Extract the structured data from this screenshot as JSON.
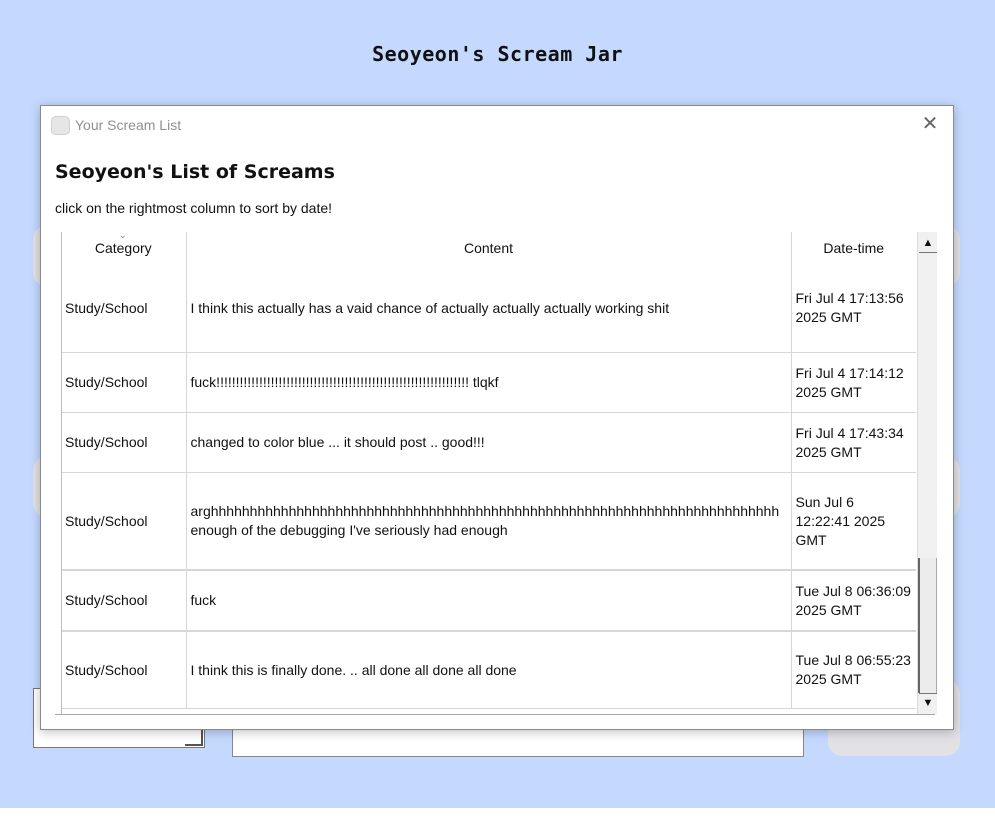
{
  "page": {
    "app_title": "Seoyeon's Scream Jar"
  },
  "dialog": {
    "window_title": "Your Scream List",
    "close_label": "✕",
    "heading": "Seoyeon's List of Screams",
    "hint": "click on the rightmost column to sort by date!"
  },
  "table": {
    "columns": [
      "Category",
      "Content",
      "Date-time"
    ],
    "rows": [
      {
        "category": "Study/School",
        "content": "I think this actually has a vaid chance of actually actually actually working shit",
        "datetime": "Fri Jul 4 17:13:56 2025 GMT"
      },
      {
        "category": "Study/School",
        "content": "fuck!!!!!!!!!!!!!!!!!!!!!!!!!!!!!!!!!!!!!!!!!!!!!!!!!!!!!!!!!!!!!!!!! tlqkf",
        "datetime": "Fri Jul 4 17:14:12 2025 GMT"
      },
      {
        "category": "Study/School",
        "content": "changed to color blue ... it should post .. good!!!",
        "datetime": "Fri Jul 4 17:43:34 2025 GMT"
      },
      {
        "category": "Study/School",
        "content": "arghhhhhhhhhhhhhhhhhhhhhhhhhhhhhhhhhhhhhhhhhhhhhhhhhhhhhhhhhhhhhhhhhhhhhhhhh enough of the debugging I've seriously had enough",
        "datetime": "Sun Jul 6 12:22:41 2025 GMT"
      },
      {
        "category": "Study/School",
        "content": "fuck",
        "datetime": "Tue Jul 8 06:36:09 2025 GMT"
      },
      {
        "category": "Study/School",
        "content": "I think this is finally done. .. all done all done all done",
        "datetime": "Tue Jul 8 06:55:23 2025 GMT"
      }
    ]
  },
  "scrollbar": {
    "up_icon": "▲",
    "down_icon": "▼"
  },
  "icons": {
    "window": "app-icon",
    "close": "close-icon",
    "sort": "chevron-down-icon"
  },
  "colors": {
    "background": "#c5d9ff",
    "dialog": "#ffffff"
  }
}
